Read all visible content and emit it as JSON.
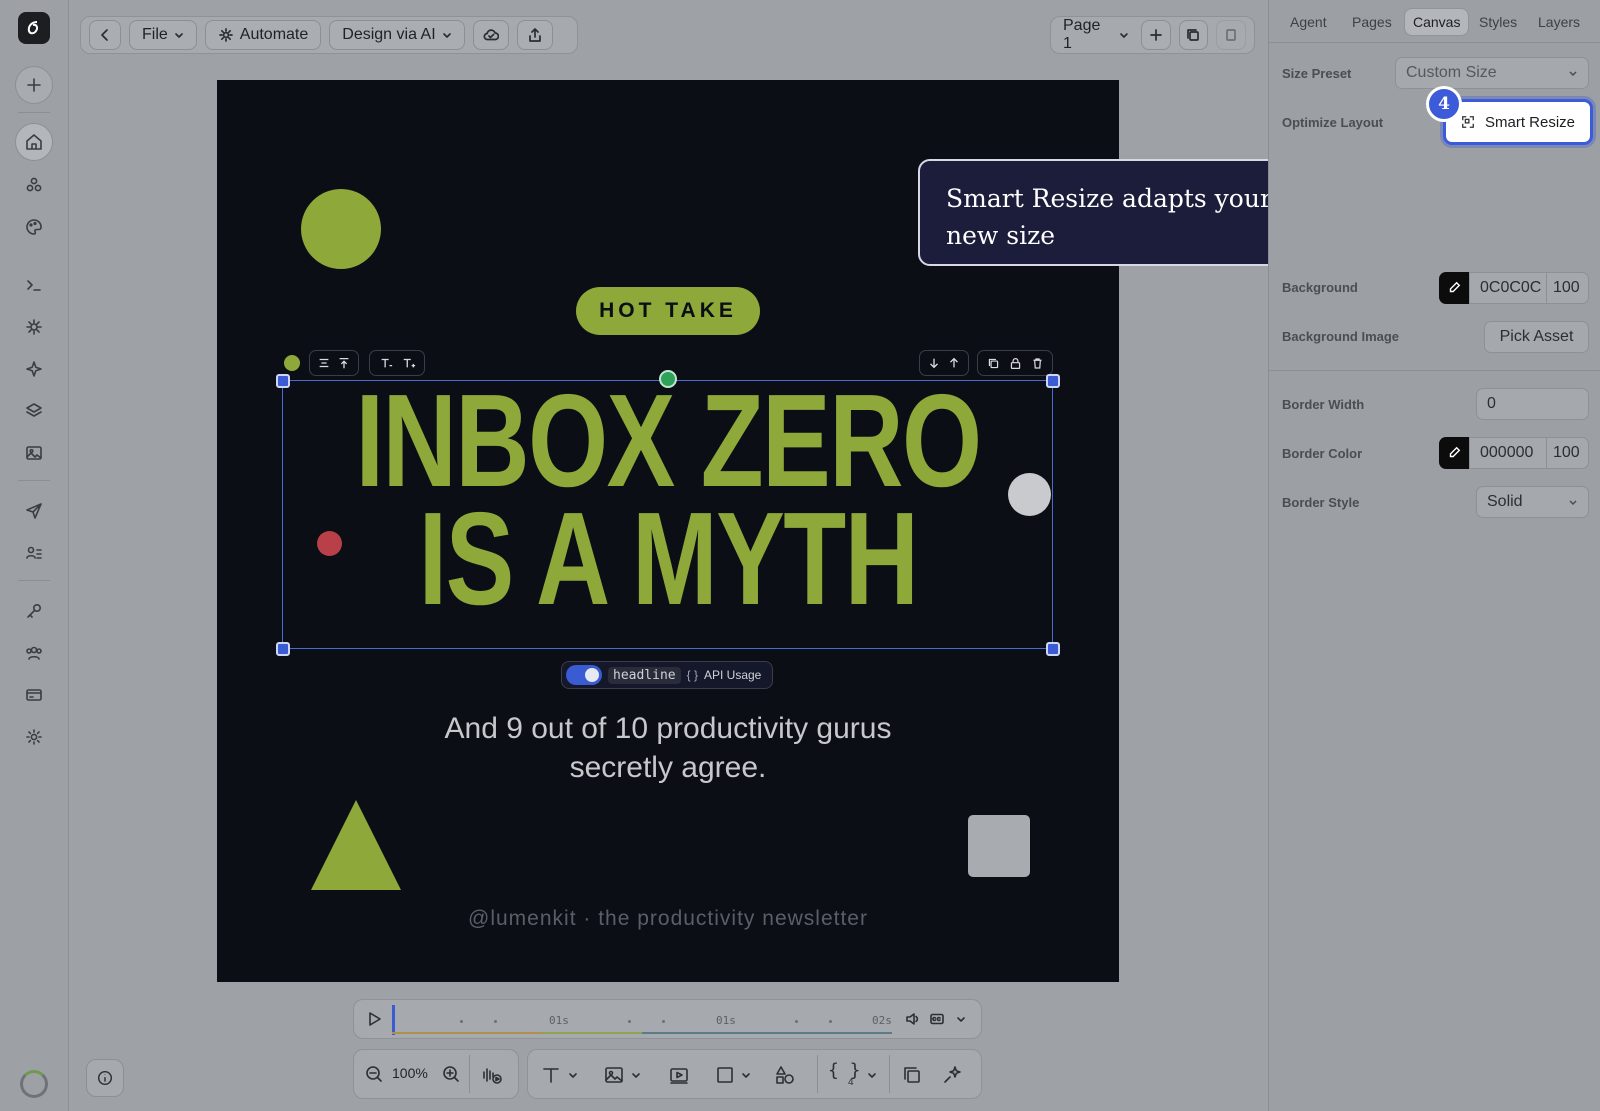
{
  "toolbar": {
    "file_label": "File",
    "automate_label": "Automate",
    "design_ai_label": "Design via AI",
    "page_label": "Page 1"
  },
  "panel": {
    "tabs": [
      "Agent",
      "Pages",
      "Canvas",
      "Styles",
      "Layers"
    ],
    "active_tab": "Canvas",
    "size_preset_label": "Size Preset",
    "size_preset_value": "Custom Size",
    "optimize_layout_label": "Optimize Layout",
    "smart_resize_label": "Smart Resize",
    "step_badge": "4",
    "background_label": "Background",
    "background_hex": "0C0C0C",
    "background_opacity": "100",
    "background_image_label": "Background Image",
    "pick_asset_label": "Pick Asset",
    "border_width_label": "Border Width",
    "border_width_value": "0",
    "border_color_label": "Border Color",
    "border_color_hex": "000000",
    "border_color_opacity": "100",
    "border_style_label": "Border Style",
    "border_style_value": "Solid"
  },
  "tooltip": {
    "text": "Smart Resize adapts your whole layout to the new size"
  },
  "canvas": {
    "badge": "HOT TAKE",
    "title_line1": "INBOX ZERO",
    "title_line2": "IS A MYTH",
    "subtitle_line1": "And 9 out of 10 productivity gurus",
    "subtitle_line2": "secretly agree.",
    "footer": "@lumenkit · the productivity newsletter",
    "layer_name": "headline",
    "api_usage_label": "API Usage",
    "colors": {
      "bg": "#0c0e16",
      "accent": "#8fa83a",
      "red": "#b94048",
      "gray": "#c8cacd"
    }
  },
  "timeline": {
    "markers": [
      "01s",
      "01s",
      "02s"
    ]
  },
  "zoom": {
    "level": "100%"
  },
  "tools": {
    "variables_count": "4"
  }
}
